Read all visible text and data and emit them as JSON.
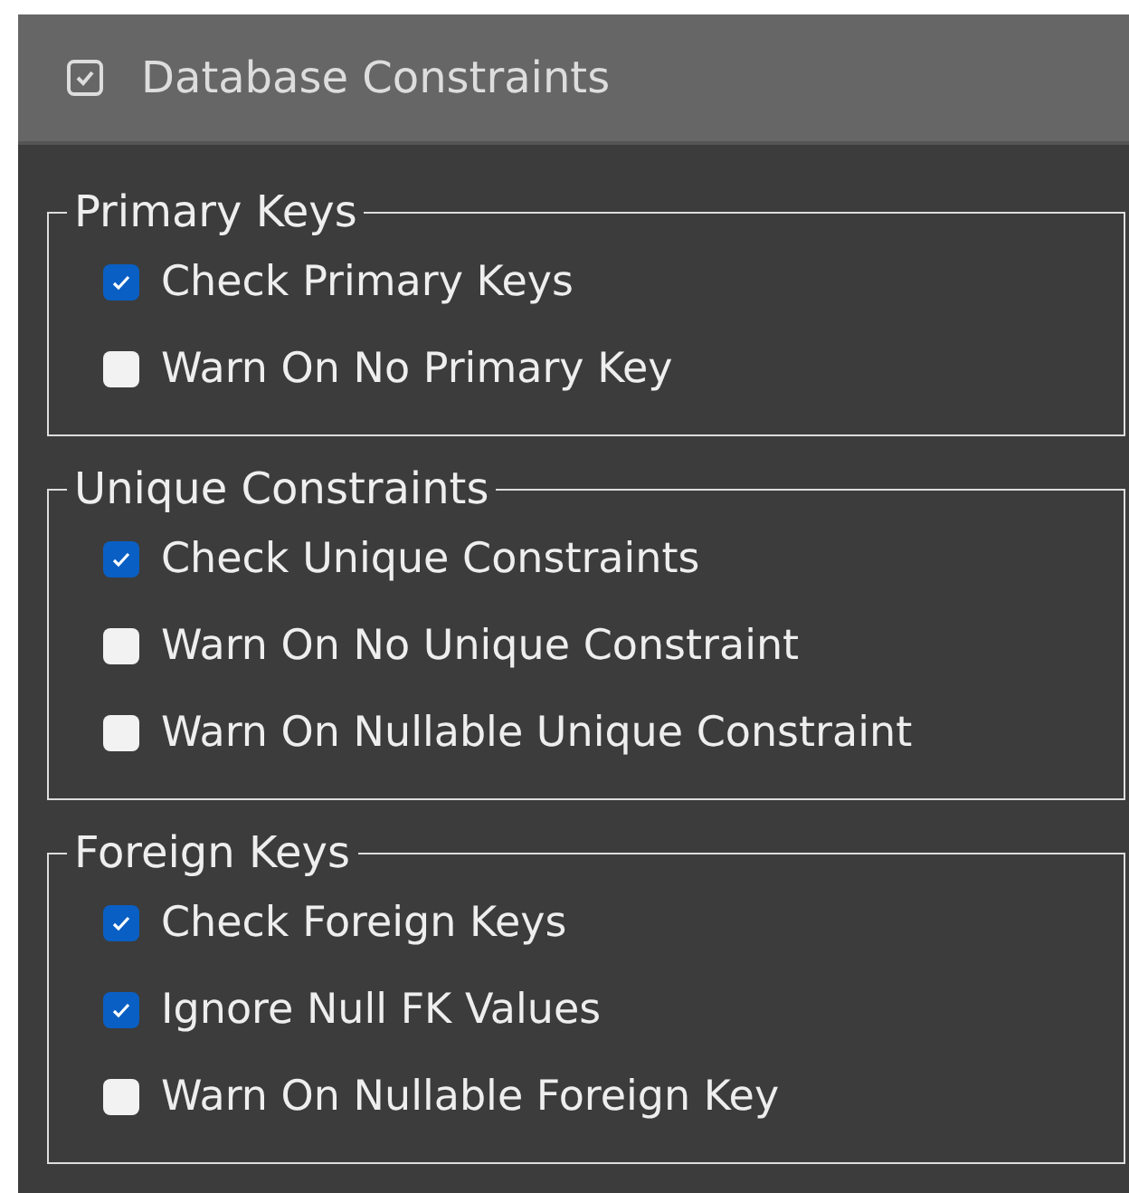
{
  "header": {
    "title": "Database Constraints"
  },
  "groups": [
    {
      "title": "Primary Keys",
      "options": [
        {
          "label": "Check Primary Keys",
          "checked": true
        },
        {
          "label": "Warn On No Primary Key",
          "checked": false
        }
      ]
    },
    {
      "title": "Unique Constraints",
      "options": [
        {
          "label": "Check Unique Constraints",
          "checked": true
        },
        {
          "label": "Warn On No Unique Constraint",
          "checked": false
        },
        {
          "label": "Warn On Nullable Unique Constraint",
          "checked": false
        }
      ]
    },
    {
      "title": "Foreign Keys",
      "options": [
        {
          "label": "Check Foreign Keys",
          "checked": true
        },
        {
          "label": "Ignore Null FK Values",
          "checked": true
        },
        {
          "label": "Warn On Nullable Foreign Key",
          "checked": false
        }
      ]
    }
  ]
}
